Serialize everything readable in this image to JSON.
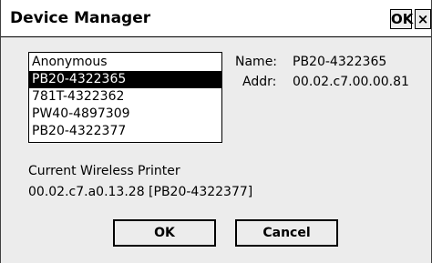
{
  "window": {
    "title": "Device Manager",
    "ok_label": "OK",
    "close_label": "×"
  },
  "device_list": {
    "items": [
      "Anonymous",
      "PB20-4322365",
      "781T-4322362",
      "PW40-4897309",
      "PB20-4322377"
    ],
    "selected_index": 1
  },
  "details": {
    "name_label": "Name:",
    "name_value": "PB20-4322365",
    "addr_label": "Addr:",
    "addr_value": "00.02.c7.00.00.81"
  },
  "current_printer": {
    "label": "Current Wireless Printer",
    "value": "00.02.c7.a0.13.28 [PB20-4322377]"
  },
  "buttons": {
    "ok": "OK",
    "cancel": "Cancel"
  }
}
